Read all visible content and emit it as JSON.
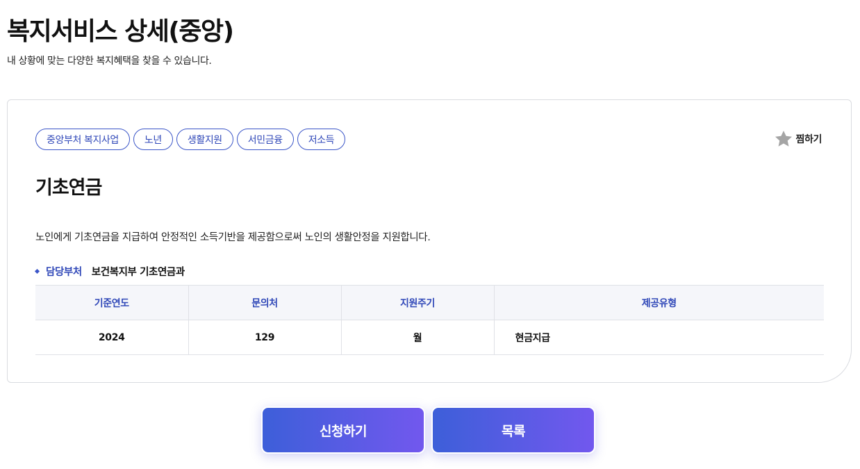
{
  "header": {
    "title": "복지서비스 상세(중앙)",
    "subtitle": "내 상황에 맞는 다양한 복지혜택을 찾을 수 있습니다."
  },
  "card": {
    "tags": [
      "중앙부처 복지사업",
      "노년",
      "생활지원",
      "서민금융",
      "저소득"
    ],
    "favorite": {
      "label": "찜하기",
      "icon": "star-icon"
    },
    "title": "기초연금",
    "description": "노인에게 기초연금을 지급하여 안정적인 소득기반을 제공함으로써 노인의 생활안정을 지원합니다.",
    "department": {
      "label": "담당부처",
      "value": "보건복지부 기초연금과"
    },
    "table": {
      "headers": [
        "기준연도",
        "문의처",
        "지원주기",
        "제공유형"
      ],
      "row": [
        "2024",
        "129",
        "월",
        "현금지급"
      ]
    }
  },
  "actions": {
    "apply_label": "신청하기",
    "list_label": "목록"
  },
  "colors": {
    "accent": "#3a55c8",
    "button_gradient_start": "#3d5fd9",
    "button_gradient_end": "#7258ee",
    "star": "#a5a5a5"
  }
}
